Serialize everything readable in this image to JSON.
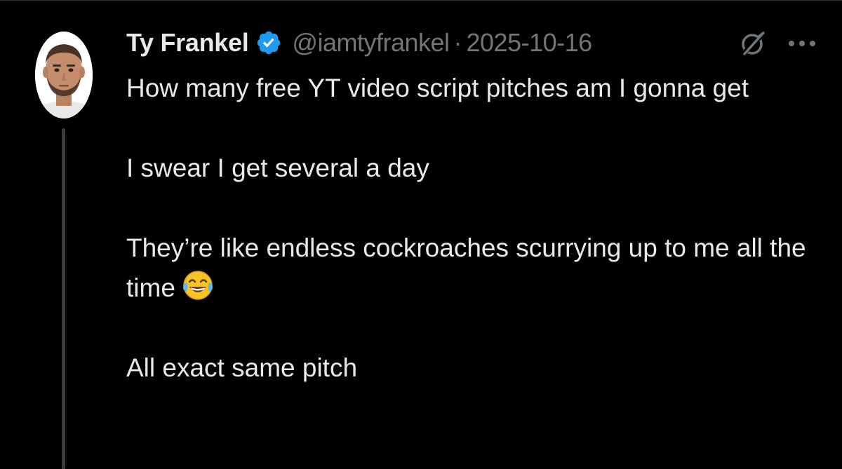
{
  "tweet": {
    "author_name": "Ty Frankel",
    "handle": "@iamtyfrankel",
    "separator": "·",
    "date": "2025-10-16",
    "lines": {
      "line1": "How many free YT video script pitches am I gonna get",
      "line2": "I swear I get several a day",
      "line3": "They’re like endless cockroaches scurrying up to me all the time",
      "line4": "All exact same pitch"
    },
    "emoji": "face-with-tears-of-joy"
  },
  "icons": {
    "verified": "verified-badge-icon",
    "grok": "grok-icon",
    "more": "more-options-icon"
  },
  "colors": {
    "background": "#000000",
    "text": "#e7e9ea",
    "muted": "#71767b",
    "verified_blue": "#1d9bf0",
    "thread_line": "#3a3d40"
  }
}
